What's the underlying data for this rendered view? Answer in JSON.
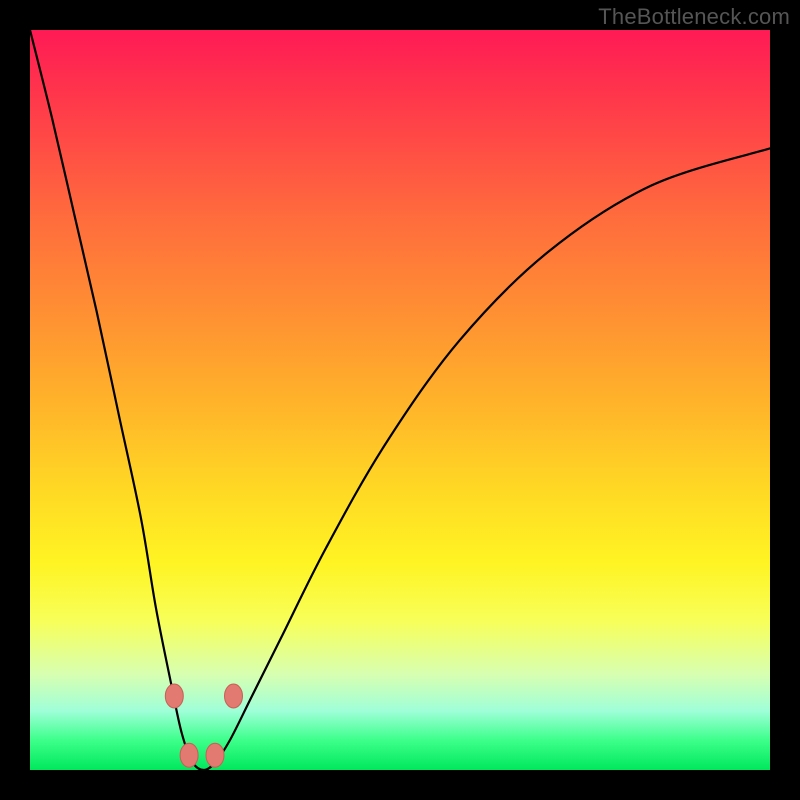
{
  "attribution": "TheBottleneck.com",
  "colors": {
    "frame": "#000000",
    "gradient_stops": [
      {
        "pct": 0,
        "hex": "#ff1a55"
      },
      {
        "pct": 10,
        "hex": "#ff3a4a"
      },
      {
        "pct": 25,
        "hex": "#ff6b3d"
      },
      {
        "pct": 38,
        "hex": "#ff8f33"
      },
      {
        "pct": 50,
        "hex": "#ffb22a"
      },
      {
        "pct": 62,
        "hex": "#ffd824"
      },
      {
        "pct": 72,
        "hex": "#fff423"
      },
      {
        "pct": 80,
        "hex": "#f7ff5a"
      },
      {
        "pct": 87,
        "hex": "#d8ffb0"
      },
      {
        "pct": 92,
        "hex": "#9fffd8"
      },
      {
        "pct": 96,
        "hex": "#3cff8a"
      },
      {
        "pct": 100,
        "hex": "#00e85c"
      }
    ],
    "curve_stroke": "#000000",
    "marker_fill": "#e27a72",
    "marker_stroke": "#c85f56"
  },
  "chart_data": {
    "type": "line",
    "title": "",
    "xlabel": "",
    "ylabel": "",
    "xlim": [
      0,
      100
    ],
    "ylim": [
      0,
      100
    ],
    "grid": false,
    "legend": false,
    "series": [
      {
        "name": "bottleneck-curve",
        "x": [
          0,
          3,
          6,
          9,
          12,
          15,
          17,
          19,
          20.5,
          22,
          23.5,
          25,
          27,
          30,
          34,
          40,
          48,
          58,
          70,
          84,
          100
        ],
        "y": [
          100,
          88,
          75,
          62,
          48,
          34,
          22,
          12,
          5,
          1,
          0,
          1,
          4,
          10,
          18,
          30,
          44,
          58,
          70,
          79,
          84
        ]
      }
    ],
    "markers": [
      {
        "x": 19.5,
        "y": 10
      },
      {
        "x": 21.5,
        "y": 2
      },
      {
        "x": 25.0,
        "y": 2
      },
      {
        "x": 27.5,
        "y": 10
      }
    ],
    "notes": "V-shaped bottleneck curve over vertical red-to-green gradient; minimum near x≈23; right branch asymptotes below 100."
  }
}
